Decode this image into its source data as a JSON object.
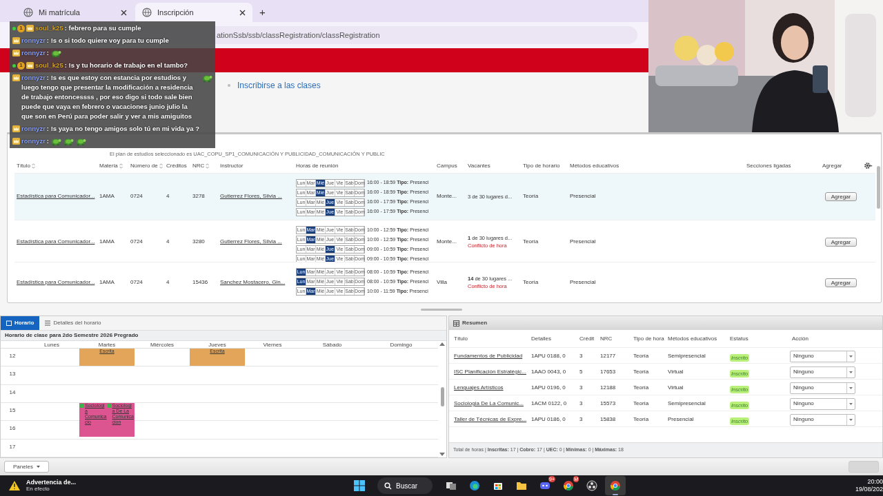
{
  "browser": {
    "tabs": [
      {
        "title": "Mi matrícula",
        "selected": false
      },
      {
        "title": "Inscripción",
        "selected": true
      }
    ],
    "new_tab": "+",
    "url": "ationSsb/ssb/classRegistration/classRegistration"
  },
  "breadcrumb": [
    {
      "label": "Inscribirse a las clases",
      "current": true
    }
  ],
  "chat": [
    {
      "user": "soul_k25",
      "color": "#d9a520",
      "badges": [
        {
          "kind": "dot"
        },
        {
          "kind": "coin",
          "text": "1"
        },
        {
          "kind": "crown"
        }
      ],
      "parts": [
        {
          "kind": "text",
          "text": ": febrero para su cumple"
        }
      ]
    },
    {
      "user": "ronnyzr",
      "color": "#8aa2ff",
      "badges": [
        {
          "kind": "crown"
        }
      ],
      "parts": [
        {
          "kind": "text",
          "text": ": !s o si todo quiere voy para tu cumple"
        }
      ]
    },
    {
      "user": "ronnyzr",
      "color": "#8aa2ff",
      "badges": [
        {
          "kind": "crown"
        }
      ],
      "parts": [
        {
          "kind": "text",
          "text": ":"
        },
        {
          "kind": "emote"
        }
      ]
    },
    {
      "user": "soul_k25",
      "color": "#d9a520",
      "badges": [
        {
          "kind": "dot"
        },
        {
          "kind": "coin",
          "text": "1"
        },
        {
          "kind": "crown"
        }
      ],
      "parts": [
        {
          "kind": "text",
          "text": ": !s y tu horario de trabajo en el tambo?"
        }
      ]
    },
    {
      "user": "ronnyzr",
      "color": "#8aa2ff",
      "badges": [
        {
          "kind": "crown"
        }
      ],
      "parts": [
        {
          "kind": "text",
          "text": ": !s es que estoy con estancia por estudios y luego tengo que presentar la modificación a residencia de trabajo entoncessss , por eso digo si todo sale bien puede que vaya en febrero o vacaciones junio julio la que son en Perú para poder salir y ver a mis amiguitos"
        },
        {
          "kind": "emote"
        }
      ]
    },
    {
      "user": "ronnyzr",
      "color": "#8aa2ff",
      "badges": [
        {
          "kind": "crown"
        }
      ],
      "parts": [
        {
          "kind": "text",
          "text": ": !s yaya no tengo amigos solo tú en mi vida ya ?"
        }
      ]
    },
    {
      "user": "ronnyzr",
      "color": "#8aa2ff",
      "badges": [
        {
          "kind": "crown"
        }
      ],
      "parts": [
        {
          "kind": "text",
          "text": ":"
        },
        {
          "kind": "emote"
        },
        {
          "kind": "emote"
        },
        {
          "kind": "emote"
        }
      ]
    }
  ],
  "search_results": {
    "plan": "El plan de estudios seleccionado es UAC_COPU_SP1_COMUNICACIÓN Y PUBLICIDAD_COMUNICACIÓN Y PUBLIC",
    "columns": [
      {
        "label": "Título",
        "sortable": true
      },
      {
        "label": "Materia",
        "sortable": true
      },
      {
        "label": "Número de",
        "sortable": true
      },
      {
        "label": "Créditos",
        "sortable": false
      },
      {
        "label": "NRC",
        "sortable": true
      },
      {
        "label": "Instructor",
        "sortable": false
      },
      {
        "label": "Horas de reunión",
        "sortable": false
      },
      {
        "label": "Campus",
        "sortable": false
      },
      {
        "label": "Vacantes",
        "sortable": false
      },
      {
        "label": "Tipo de horario",
        "sortable": false
      },
      {
        "label": "Métodos educativos",
        "sortable": false
      },
      {
        "label": "Secciones ligadas",
        "sortable": false
      },
      {
        "label": "Agregar",
        "sortable": false
      }
    ],
    "rows": [
      {
        "selected": true,
        "title": "Estadística para Comunicador...",
        "subject": "1AMA",
        "number": "0724",
        "credits": "4",
        "nrc": "3278",
        "instructor": "Gutierrez Flores, Silvia ...",
        "meetings": [
          {
            "text": "16:00 - 18:59 **Tipo:** Presenci",
            "days": [
              {
                "label": "Lun",
                "selected": false
              },
              {
                "label": "Mar",
                "selected": false
              },
              {
                "label": "Mié",
                "selected": true
              },
              {
                "label": "Jue",
                "selected": false
              },
              {
                "label": "Vie",
                "selected": false
              },
              {
                "label": "Sáb",
                "selected": false
              },
              {
                "label": "Dom",
                "selected": false
              }
            ]
          },
          {
            "text": "16:00 - 18:59 **Tipo:** Presenci",
            "days": [
              {
                "label": "Lun",
                "selected": false
              },
              {
                "label": "Mar",
                "selected": false
              },
              {
                "label": "Mié",
                "selected": true
              },
              {
                "label": "Jue",
                "selected": false
              },
              {
                "label": "Vie",
                "selected": false
              },
              {
                "label": "Sáb",
                "selected": false
              },
              {
                "label": "Dom",
                "selected": false
              }
            ]
          },
          {
            "text": "16:00 - 17:59 **Tipo:** Presenci",
            "days": [
              {
                "label": "Lun",
                "selected": false
              },
              {
                "label": "Mar",
                "selected": false
              },
              {
                "label": "Mié",
                "selected": false
              },
              {
                "label": "Jue",
                "selected": true
              },
              {
                "label": "Vie",
                "selected": false
              },
              {
                "label": "Sáb",
                "selected": false
              },
              {
                "label": "Dom",
                "selected": false
              }
            ]
          },
          {
            "text": "16:00 - 17:59 **Tipo:** Presenci",
            "days": [
              {
                "label": "Lun",
                "selected": false
              },
              {
                "label": "Mar",
                "selected": false
              },
              {
                "label": "Mié",
                "selected": false
              },
              {
                "label": "Jue",
                "selected": true
              },
              {
                "label": "Vie",
                "selected": false
              },
              {
                "label": "Sáb",
                "selected": false
              },
              {
                "label": "Dom",
                "selected": false
              }
            ]
          }
        ],
        "campus": "Monte...",
        "vacancy": "3 de 30 lugares d...",
        "schedule_type": "Teoría",
        "method": "Presencial",
        "add": "Agregar"
      },
      {
        "selected": false,
        "title": "Estadística para Comunicador...",
        "subject": "1AMA",
        "number": "0724",
        "credits": "4",
        "nrc": "3280",
        "instructor": "Gutierrez Flores, Silvia ...",
        "meetings": [
          {
            "text": "10:00 - 12:59 **Tipo:** Presenci",
            "days": [
              {
                "label": "Lun",
                "selected": false
              },
              {
                "label": "Mar",
                "selected": true
              },
              {
                "label": "Mié",
                "selected": false
              },
              {
                "label": "Jue",
                "selected": false
              },
              {
                "label": "Vie",
                "selected": false
              },
              {
                "label": "Sáb",
                "selected": false
              },
              {
                "label": "Dom",
                "selected": false
              }
            ]
          },
          {
            "text": "10:00 - 12:59 **Tipo:** Presenci",
            "days": [
              {
                "label": "Lun",
                "selected": false
              },
              {
                "label": "Mar",
                "selected": true
              },
              {
                "label": "Mié",
                "selected": false
              },
              {
                "label": "Jue",
                "selected": false
              },
              {
                "label": "Vie",
                "selected": false
              },
              {
                "label": "Sáb",
                "selected": false
              },
              {
                "label": "Dom",
                "selected": false
              }
            ]
          },
          {
            "text": "09:00 - 10:59 **Tipo:** Presenci",
            "days": [
              {
                "label": "Lun",
                "selected": false
              },
              {
                "label": "Mar",
                "selected": false
              },
              {
                "label": "Mié",
                "selected": false
              },
              {
                "label": "Jue",
                "selected": true
              },
              {
                "label": "Vie",
                "selected": false
              },
              {
                "label": "Sáb",
                "selected": false
              },
              {
                "label": "Dom",
                "selected": false
              }
            ]
          },
          {
            "text": "09:00 - 10:59 **Tipo:** Presenci",
            "days": [
              {
                "label": "Lun",
                "selected": false
              },
              {
                "label": "Mar",
                "selected": false
              },
              {
                "label": "Mié",
                "selected": false
              },
              {
                "label": "Jue",
                "selected": true
              },
              {
                "label": "Vie",
                "selected": false
              },
              {
                "label": "Sáb",
                "selected": false
              },
              {
                "label": "Dom",
                "selected": false
              }
            ]
          }
        ],
        "campus": "Monte...",
        "vacancy": "**1** de 30 lugares d...",
        "warning": "Conflicto de hora",
        "schedule_type": "Teoría",
        "method": "Presencial",
        "add": "Agregar"
      },
      {
        "selected": false,
        "title": "Estadística para Comunicador...",
        "subject": "1AMA",
        "number": "0724",
        "credits": "4",
        "nrc": "15436",
        "instructor": "Sanchez Mostacero, Gin...",
        "meetings": [
          {
            "text": "08:00 - 10:59 **Tipo:** Presenci",
            "days": [
              {
                "label": "Lun",
                "selected": true
              },
              {
                "label": "Mar",
                "selected": false
              },
              {
                "label": "Mié",
                "selected": false
              },
              {
                "label": "Jue",
                "selected": false
              },
              {
                "label": "Vie",
                "selected": false
              },
              {
                "label": "Sáb",
                "selected": false
              },
              {
                "label": "Dom",
                "selected": false
              }
            ]
          },
          {
            "text": "08:00 - 10:59 **Tipo:** Presenci",
            "days": [
              {
                "label": "Lun",
                "selected": true
              },
              {
                "label": "Mar",
                "selected": false
              },
              {
                "label": "Mié",
                "selected": false
              },
              {
                "label": "Jue",
                "selected": false
              },
              {
                "label": "Vie",
                "selected": false
              },
              {
                "label": "Sáb",
                "selected": false
              },
              {
                "label": "Dom",
                "selected": false
              }
            ]
          },
          {
            "text": "10:00 - 11:59 **Tipo:** Presenci",
            "days": [
              {
                "label": "Lun",
                "selected": false
              },
              {
                "label": "Mar",
                "selected": true
              },
              {
                "label": "Mié",
                "selected": false
              },
              {
                "label": "Jue",
                "selected": false
              },
              {
                "label": "Vie",
                "selected": false
              },
              {
                "label": "Sáb",
                "selected": false
              },
              {
                "label": "Dom",
                "selected": false
              }
            ]
          }
        ],
        "campus": "Villa",
        "vacancy": "**14** de 30 lugares ...",
        "warning": "Conflicto de hora",
        "schedule_type": "Teoría",
        "method": "Presencial",
        "add": "Agregar"
      }
    ]
  },
  "schedule": {
    "tabs": [
      {
        "label": "Horario",
        "selected": true
      },
      {
        "label": "Detalles del horario",
        "selected": false
      }
    ],
    "title": "Horario de clase para 2do Semestre 2026 Pregrado",
    "days": [
      "Lunes",
      "Martes",
      "Miércoles",
      "Jueves",
      "Viernes",
      "Sábado",
      "Domingo"
    ],
    "hours": [
      {
        "label": "12",
        "cells": [
          {
            "kind": "empty"
          },
          {
            "kind": "event",
            "color": "#e3a55a",
            "items": [
              {
                "label": "Escrita",
                "check": false
              }
            ]
          },
          {
            "kind": "empty"
          },
          {
            "kind": "event",
            "color": "#e3a55a",
            "items": [
              {
                "label": "Escrita",
                "check": false
              }
            ]
          },
          {
            "kind": "empty"
          },
          {
            "kind": "empty"
          },
          {
            "kind": "empty"
          }
        ]
      },
      {
        "label": "13",
        "cells": [
          {
            "kind": "empty"
          },
          {
            "kind": "empty"
          },
          {
            "kind": "empty"
          },
          {
            "kind": "empty"
          },
          {
            "kind": "empty"
          },
          {
            "kind": "empty"
          },
          {
            "kind": "empty"
          }
        ]
      },
      {
        "label": "14",
        "cells": [
          {
            "kind": "empty"
          },
          {
            "kind": "empty"
          },
          {
            "kind": "empty"
          },
          {
            "kind": "empty"
          },
          {
            "kind": "empty"
          },
          {
            "kind": "empty"
          },
          {
            "kind": "empty"
          }
        ]
      },
      {
        "label": "15",
        "cells": [
          {
            "kind": "empty"
          },
          {
            "kind": "event_two_hours",
            "color": "#dc5590",
            "items": [
              {
                "label": "Sociologia Comunicacio",
                "check": true
              },
              {
                "label": "Sociologia De La Comunicacion",
                "check": true
              }
            ]
          },
          {
            "kind": "empty"
          },
          {
            "kind": "empty"
          },
          {
            "kind": "empty"
          },
          {
            "kind": "empty"
          },
          {
            "kind": "empty"
          }
        ]
      },
      {
        "label": "16",
        "cells": [
          {
            "kind": "empty"
          },
          {
            "kind": "empty"
          },
          {
            "kind": "empty"
          },
          {
            "kind": "empty"
          },
          {
            "kind": "empty"
          },
          {
            "kind": "empty"
          },
          {
            "kind": "empty"
          }
        ]
      },
      {
        "label": "17",
        "cells": [
          {
            "kind": "empty"
          },
          {
            "kind": "empty"
          },
          {
            "kind": "empty"
          },
          {
            "kind": "empty"
          },
          {
            "kind": "empty"
          },
          {
            "kind": "empty"
          },
          {
            "kind": "empty"
          }
        ]
      }
    ]
  },
  "summary": {
    "title": "Resumen",
    "columns": [
      "Título",
      "Detalles",
      "Crédit",
      "NRC",
      "Tipo de hora",
      "Métodos educativos",
      "Estatus",
      "Acción"
    ],
    "rows": [
      {
        "title": "Fundamentos de Publicidad",
        "details": "1APU 0188, 0",
        "credits": "3",
        "nrc": "12177",
        "type": "Teoría",
        "method": "Semipresencial",
        "status": "Inscrito",
        "action": "Ninguno"
      },
      {
        "title": "ISC Planificación Estratégic...",
        "details": "1AAO 0043, 0",
        "credits": "5",
        "nrc": "17653",
        "type": "Teoría",
        "method": "Virtual",
        "status": "Inscrito",
        "action": "Ninguno"
      },
      {
        "title": "Lenguajes Artísticos",
        "details": "1APU 0196, 0",
        "credits": "3",
        "nrc": "12188",
        "type": "Teoría",
        "method": "Virtual",
        "status": "Inscrito",
        "action": "Ninguno"
      },
      {
        "title": "Sociologia De La Comunic...",
        "details": "1ACM 0122, 0",
        "credits": "3",
        "nrc": "15573",
        "type": "Teoría",
        "method": "Semipresencial",
        "status": "Inscrito",
        "action": "Ninguno"
      },
      {
        "title": "Taller de Técnicas de Expre...",
        "details": "1APU 0186, 0",
        "credits": "3",
        "nrc": "15838",
        "type": "Teoría",
        "method": "Presencial",
        "status": "Inscrito",
        "action": "Ninguno"
      }
    ],
    "totals": "Total de horas | **Inscritas:** 17 | **Cobro:** 17 | **UEC:** 0 | **Mínimas:** 0 | **Máximas:** 18"
  },
  "footer": {
    "panels": "Paneles",
    "submit_disabled": true
  },
  "taskbar": {
    "notification": {
      "title": "Advertencia de...",
      "subtitle": "En efecto"
    },
    "search": "Buscar",
    "apps": [
      {
        "kind": "taskview",
        "active": false
      },
      {
        "kind": "edge",
        "active": false
      },
      {
        "kind": "store",
        "active": false
      },
      {
        "kind": "folder",
        "active": false
      },
      {
        "kind": "discord",
        "badge": "9+",
        "active": false
      },
      {
        "kind": "chrome",
        "badge": "M",
        "active": false
      },
      {
        "kind": "obs",
        "active": false
      },
      {
        "kind": "chrome",
        "active": true
      }
    ],
    "time": "20:00",
    "date": "19/08/202"
  }
}
